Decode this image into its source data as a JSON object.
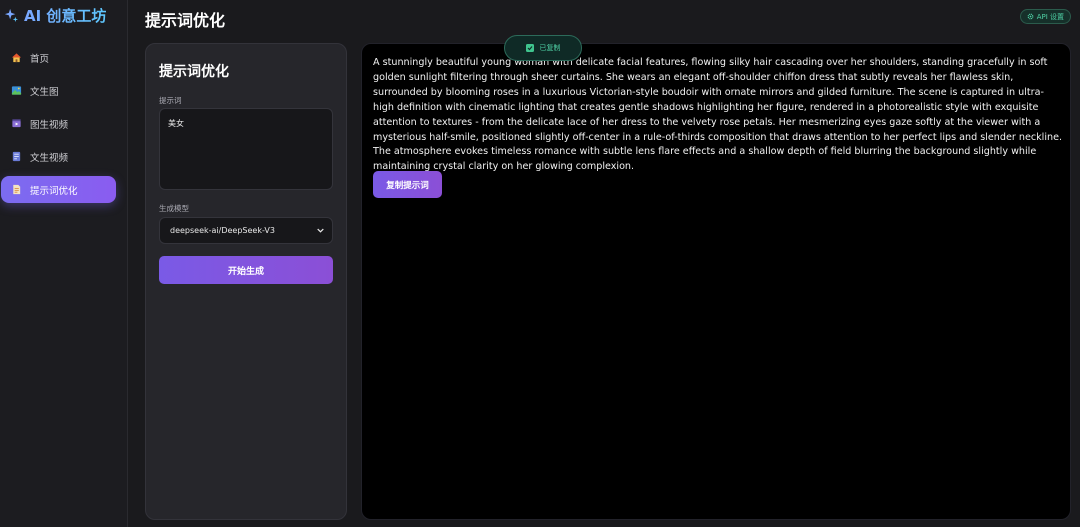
{
  "app": {
    "brand": "AI 创意工坊"
  },
  "sidebar": {
    "items": [
      {
        "label": "首页",
        "icon": "home-icon"
      },
      {
        "label": "文生图",
        "icon": "image-icon"
      },
      {
        "label": "图生视频",
        "icon": "video-icon"
      },
      {
        "label": "文生视频",
        "icon": "film-icon"
      },
      {
        "label": "提示词优化",
        "icon": "document-icon",
        "active": true
      }
    ]
  },
  "header": {
    "title": "提示词优化",
    "api_settings": "API 设置"
  },
  "toast": {
    "message": "已复制"
  },
  "form": {
    "title": "提示词优化",
    "prompt_label": "提示词",
    "prompt_value": "美女",
    "model_label": "生成模型",
    "model_selected": "deepseek-ai/DeepSeek-V3",
    "generate_label": "开始生成"
  },
  "output": {
    "text": "A stunningly beautiful young woman with delicate facial features, flowing silky hair cascading over her shoulders, standing gracefully in soft golden sunlight filtering through sheer curtains. She wears an elegant off-shoulder chiffon dress that subtly reveals her flawless skin, surrounded by blooming roses in a luxurious Victorian-style boudoir with ornate mirrors and gilded furniture. The scene is captured in ultra-high definition with cinematic lighting that creates gentle shadows highlighting her figure, rendered in a photorealistic style with exquisite attention to textures - from the delicate lace of her dress to the velvety rose petals. Her mesmerizing eyes gaze softly at the viewer with a mysterious half-smile, positioned slightly off-center in a rule-of-thirds composition that draws attention to her perfect lips and slender neckline. The atmosphere evokes timeless romance with subtle lens flare effects and a shallow depth of field blurring the background slightly while maintaining crystal clarity on her glowing complexion.",
    "copy_label": "复制提示词"
  },
  "colors": {
    "accent": "#7b6cf0",
    "success": "#4fd1a5",
    "background": "#1a1a1d"
  }
}
